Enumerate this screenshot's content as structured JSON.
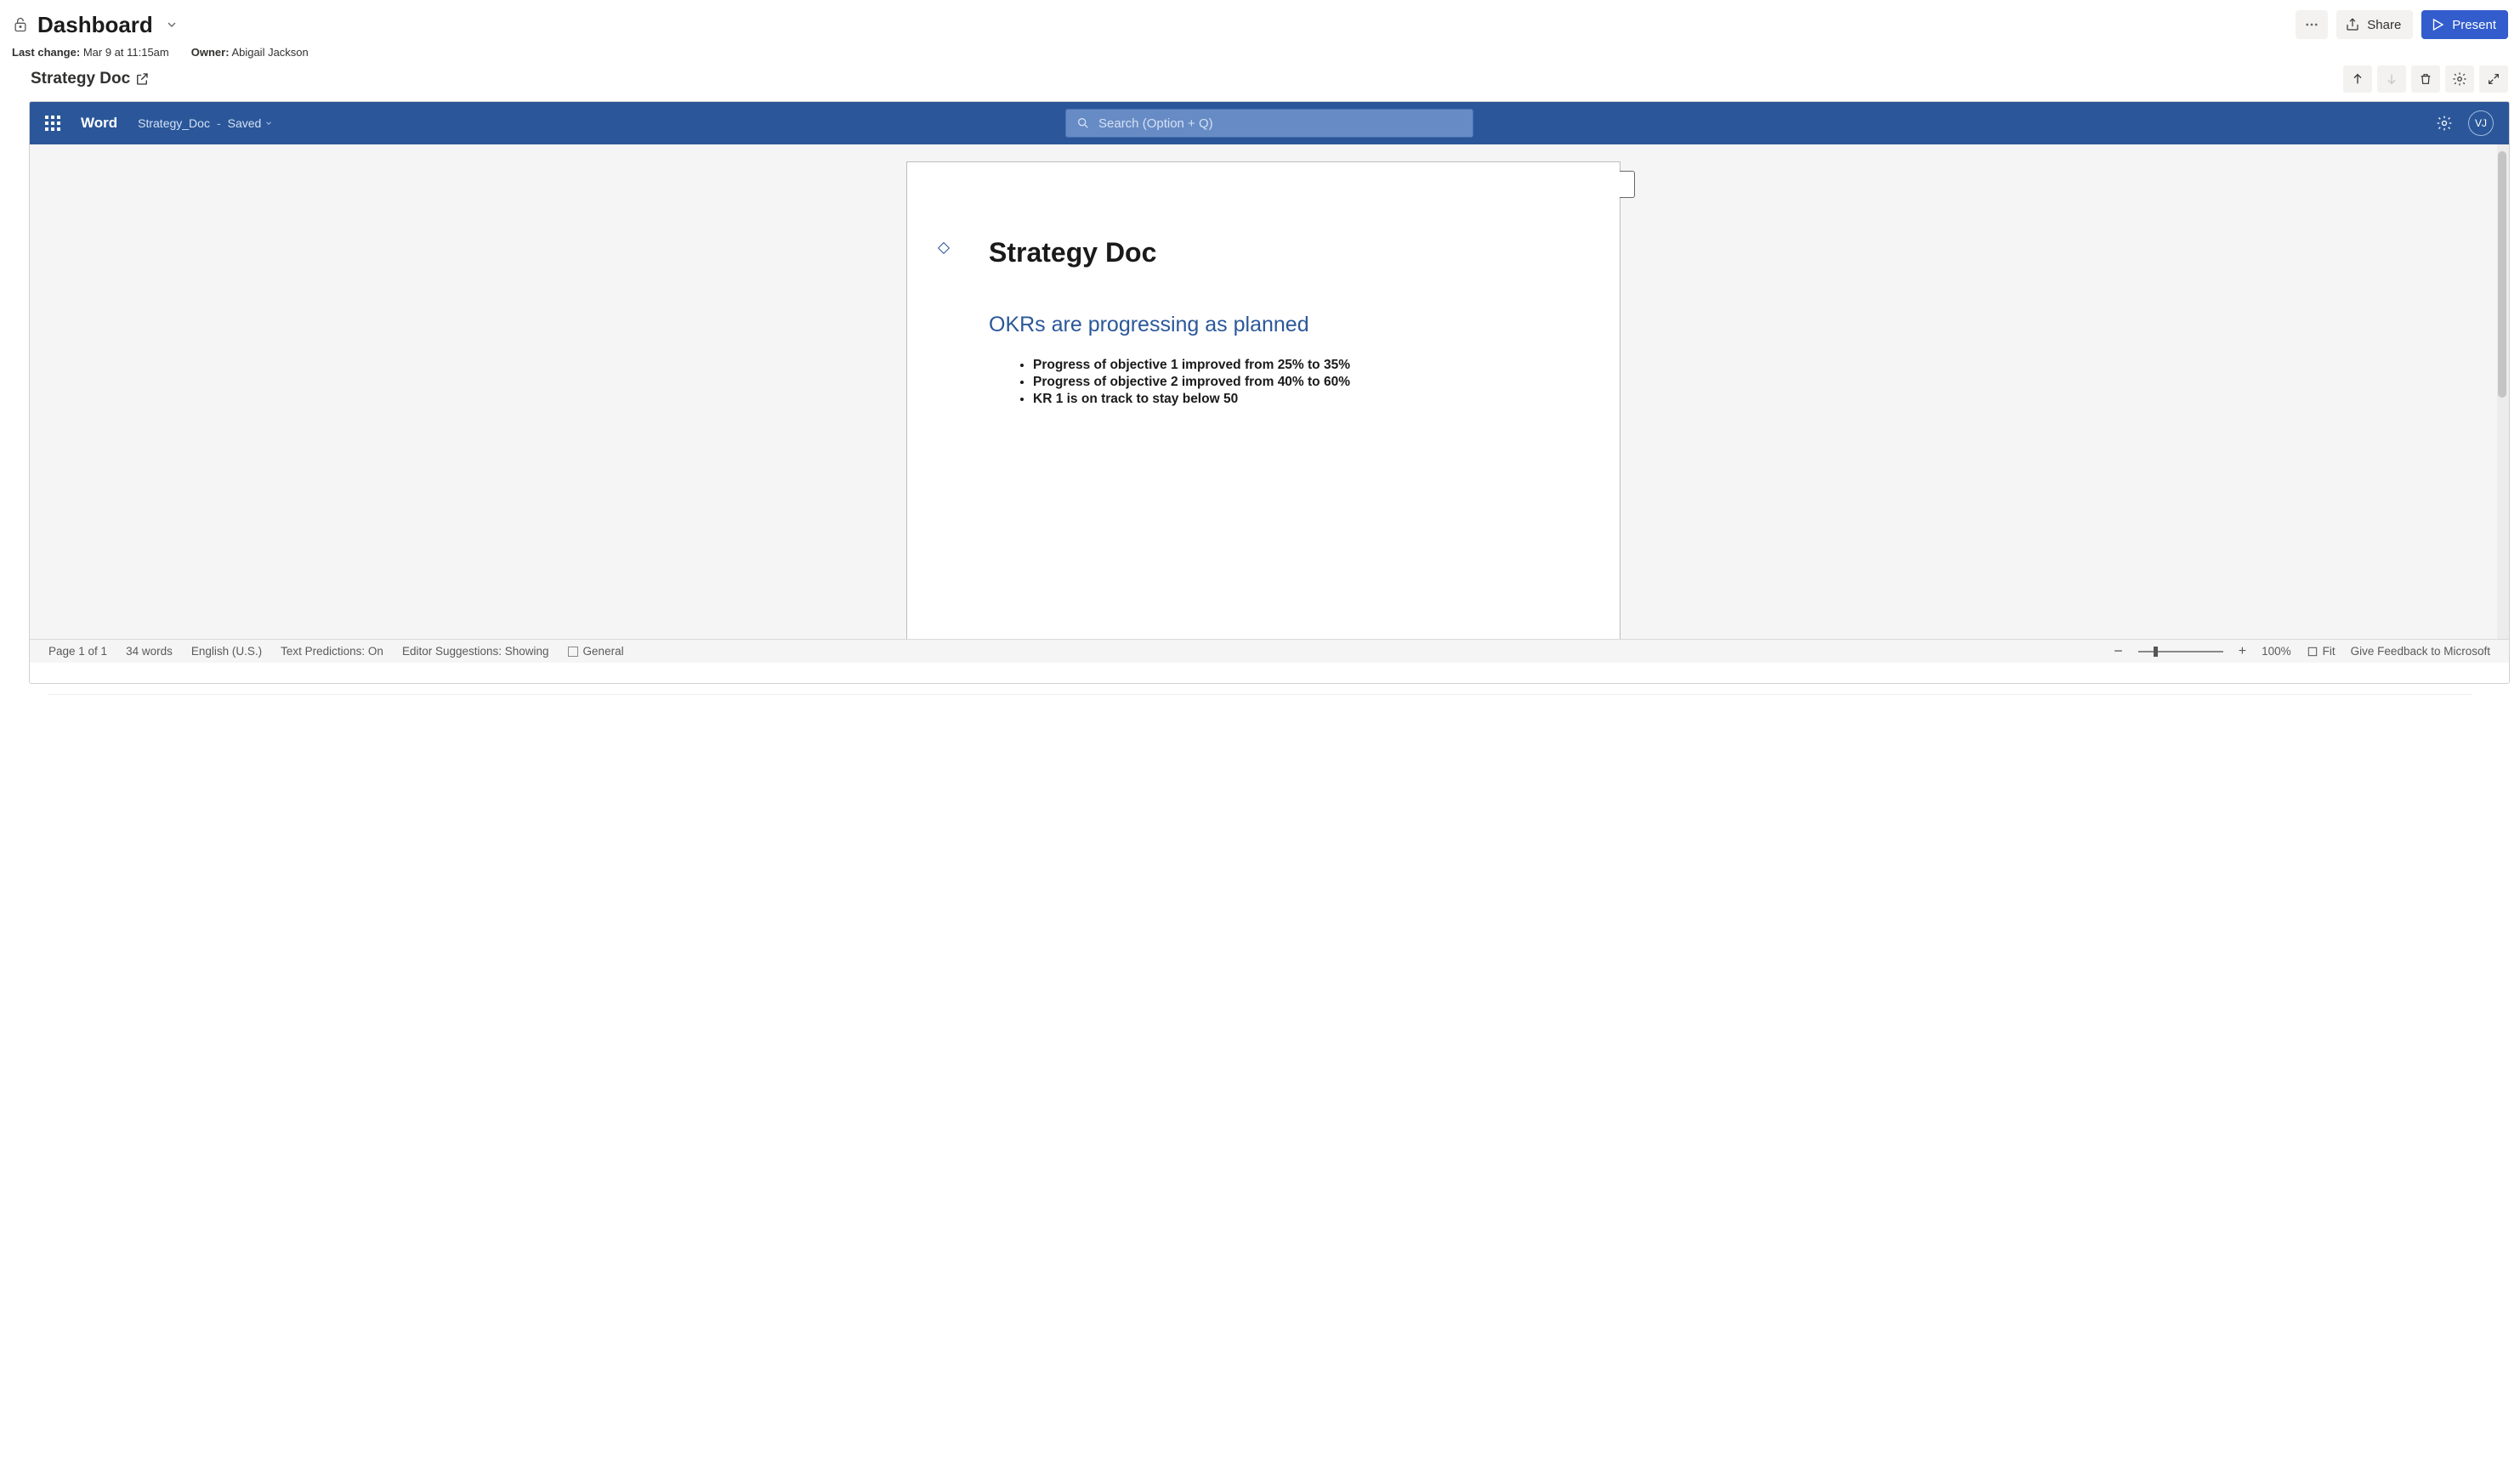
{
  "header": {
    "title": "Dashboard",
    "last_change_label": "Last change:",
    "last_change_value": "Mar 9 at 11:15am",
    "owner_label": "Owner:",
    "owner_value": "Abigail Jackson",
    "share_label": "Share",
    "present_label": "Present"
  },
  "section": {
    "title": "Strategy Doc"
  },
  "word": {
    "app_name": "Word",
    "filename": "Strategy_Doc",
    "saved": "Saved",
    "search_placeholder": "Search (Option + Q)",
    "avatar_initials": "VJ"
  },
  "document": {
    "title": "Strategy Doc",
    "heading": "OKRs are progressing as planned",
    "bullets": [
      "Progress of objective 1 improved from 25% to 35%",
      "Progress of objective 2 improved from 40% to 60%",
      "KR 1 is on track to stay below 50"
    ]
  },
  "status": {
    "page": "Page 1 of 1",
    "words": "34 words",
    "language": "English (U.S.)",
    "predictions": "Text Predictions: On",
    "editor": "Editor Suggestions: Showing",
    "general": "General",
    "zoom": "100%",
    "fit": "Fit",
    "feedback": "Give Feedback to Microsoft"
  }
}
